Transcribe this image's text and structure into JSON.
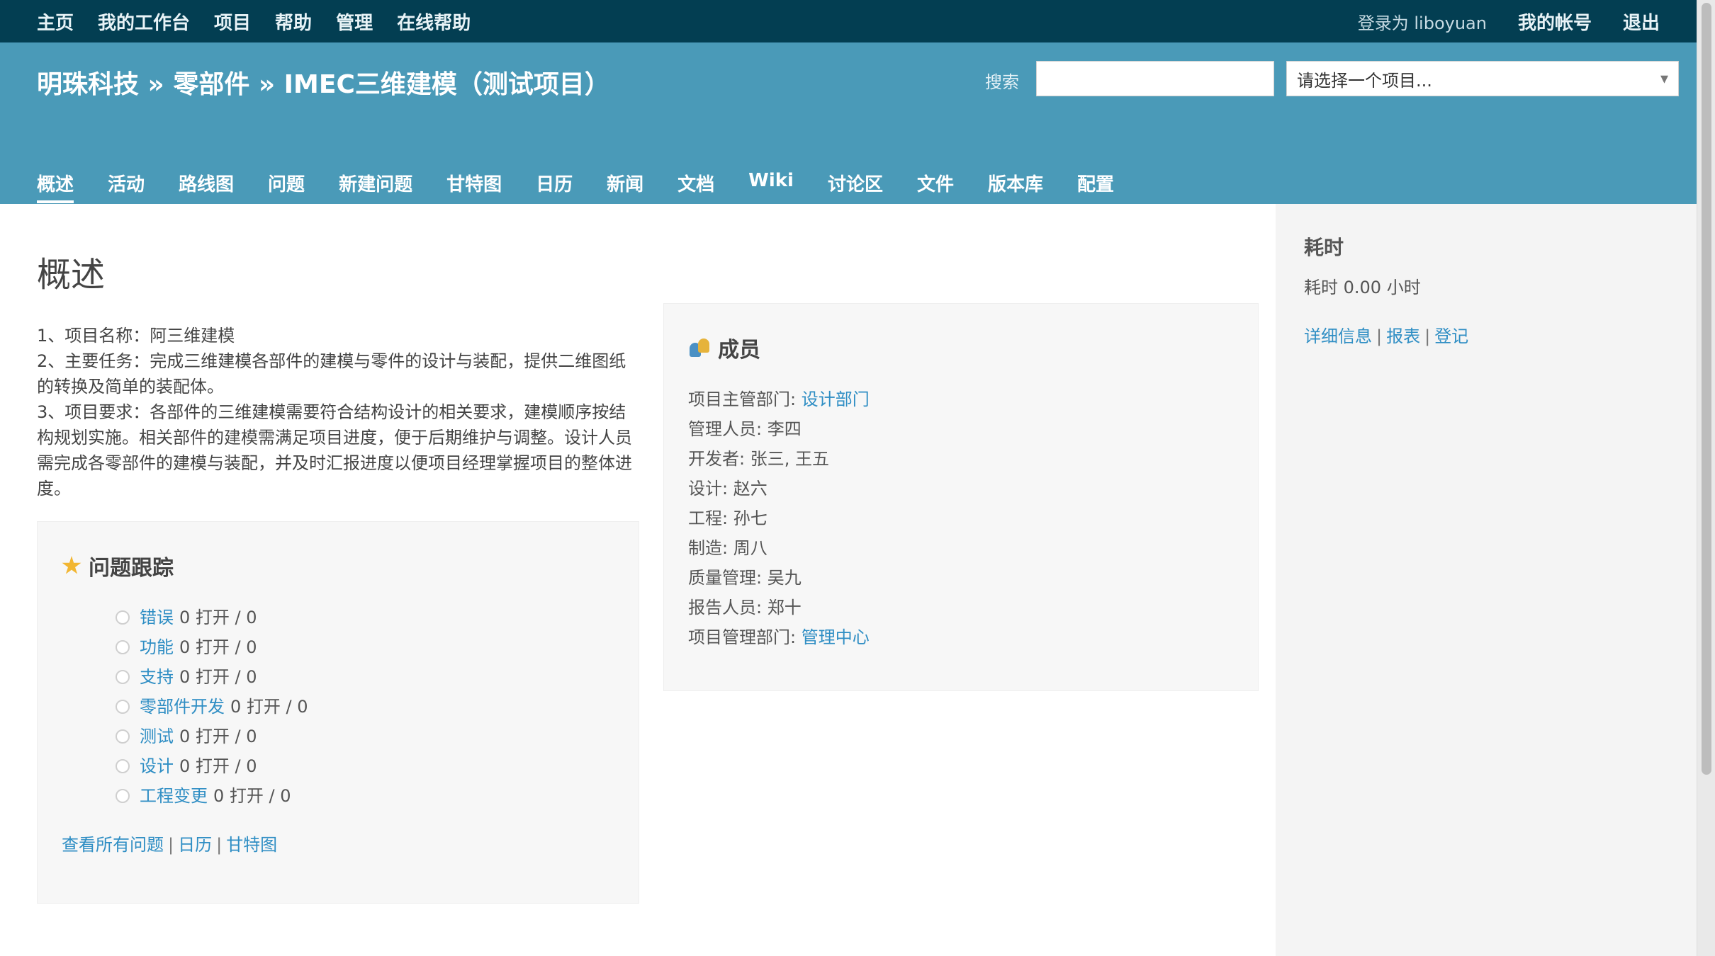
{
  "top_menu": {
    "left_items": [
      "主页",
      "我的工作台",
      "项目",
      "帮助",
      "管理",
      "在线帮助"
    ],
    "logged_in_as": "登录为 liboyuan",
    "my_account": "我的帐号",
    "logout": "退出"
  },
  "header": {
    "title": "明珠科技 » 零部件 » IMEC三维建模（测试项目）",
    "search_label": "搜索",
    "search_placeholder": "",
    "jump_selected": "请选择一个项目..."
  },
  "main_menu": [
    "概述",
    "活动",
    "路线图",
    "问题",
    "新建问题",
    "甘特图",
    "日历",
    "新闻",
    "文档",
    "Wiki",
    "讨论区",
    "文件",
    "版本库",
    "配置"
  ],
  "main_menu_selected_index": 0,
  "overview": {
    "title": "概述",
    "intro": [
      "1、项目名称：阿三维建模",
      "2、主要任务：完成三维建模各部件的建模与零件的设计与装配，提供二维图纸的转换及简单的装配体。",
      "3、项目要求：各部件的三维建模需要符合结构设计的相关要求，建模顺序按结构规划实施。相关部件的建模需满足项目进度，便于后期维护与调整。设计人员需完成各零部件的建模与装配，并及时汇报进度以便项目经理掌握项目的整体进度。"
    ]
  },
  "tracker_box": {
    "title": "问题跟踪",
    "items": [
      {
        "name": "错误",
        "stat": "0 打开 / 0"
      },
      {
        "name": "功能",
        "stat": "0 打开 / 0"
      },
      {
        "name": "支持",
        "stat": "0 打开 / 0"
      },
      {
        "name": "零部件开发",
        "stat": "0 打开 / 0"
      },
      {
        "name": "测试",
        "stat": "0 打开 / 0"
      },
      {
        "name": "设计",
        "stat": "0 打开 / 0"
      },
      {
        "name": "工程变更",
        "stat": "0 打开 / 0"
      }
    ],
    "footer_links": [
      "查看所有问题",
      "日历",
      "甘特图"
    ]
  },
  "members_box": {
    "title": "成员",
    "rows": [
      {
        "label": "项目主管部门: ",
        "link": "设计部门"
      },
      {
        "label": "管理人员: ",
        "text": "李四"
      },
      {
        "label": "开发者: ",
        "text": "张三, 王五"
      },
      {
        "label": "设计: ",
        "text": "赵六"
      },
      {
        "label": "工程: ",
        "text": "孙七"
      },
      {
        "label": "制造: ",
        "text": "周八"
      },
      {
        "label": "质量管理: ",
        "text": "吴九"
      },
      {
        "label": "报告人员: ",
        "text": "郑十"
      },
      {
        "label": "项目管理部门: ",
        "link": "管理中心"
      }
    ]
  },
  "sidebar": {
    "title": "耗时",
    "spent": "耗时 0.00 小时",
    "links": [
      "详细信息",
      "报表",
      "登记"
    ]
  }
}
